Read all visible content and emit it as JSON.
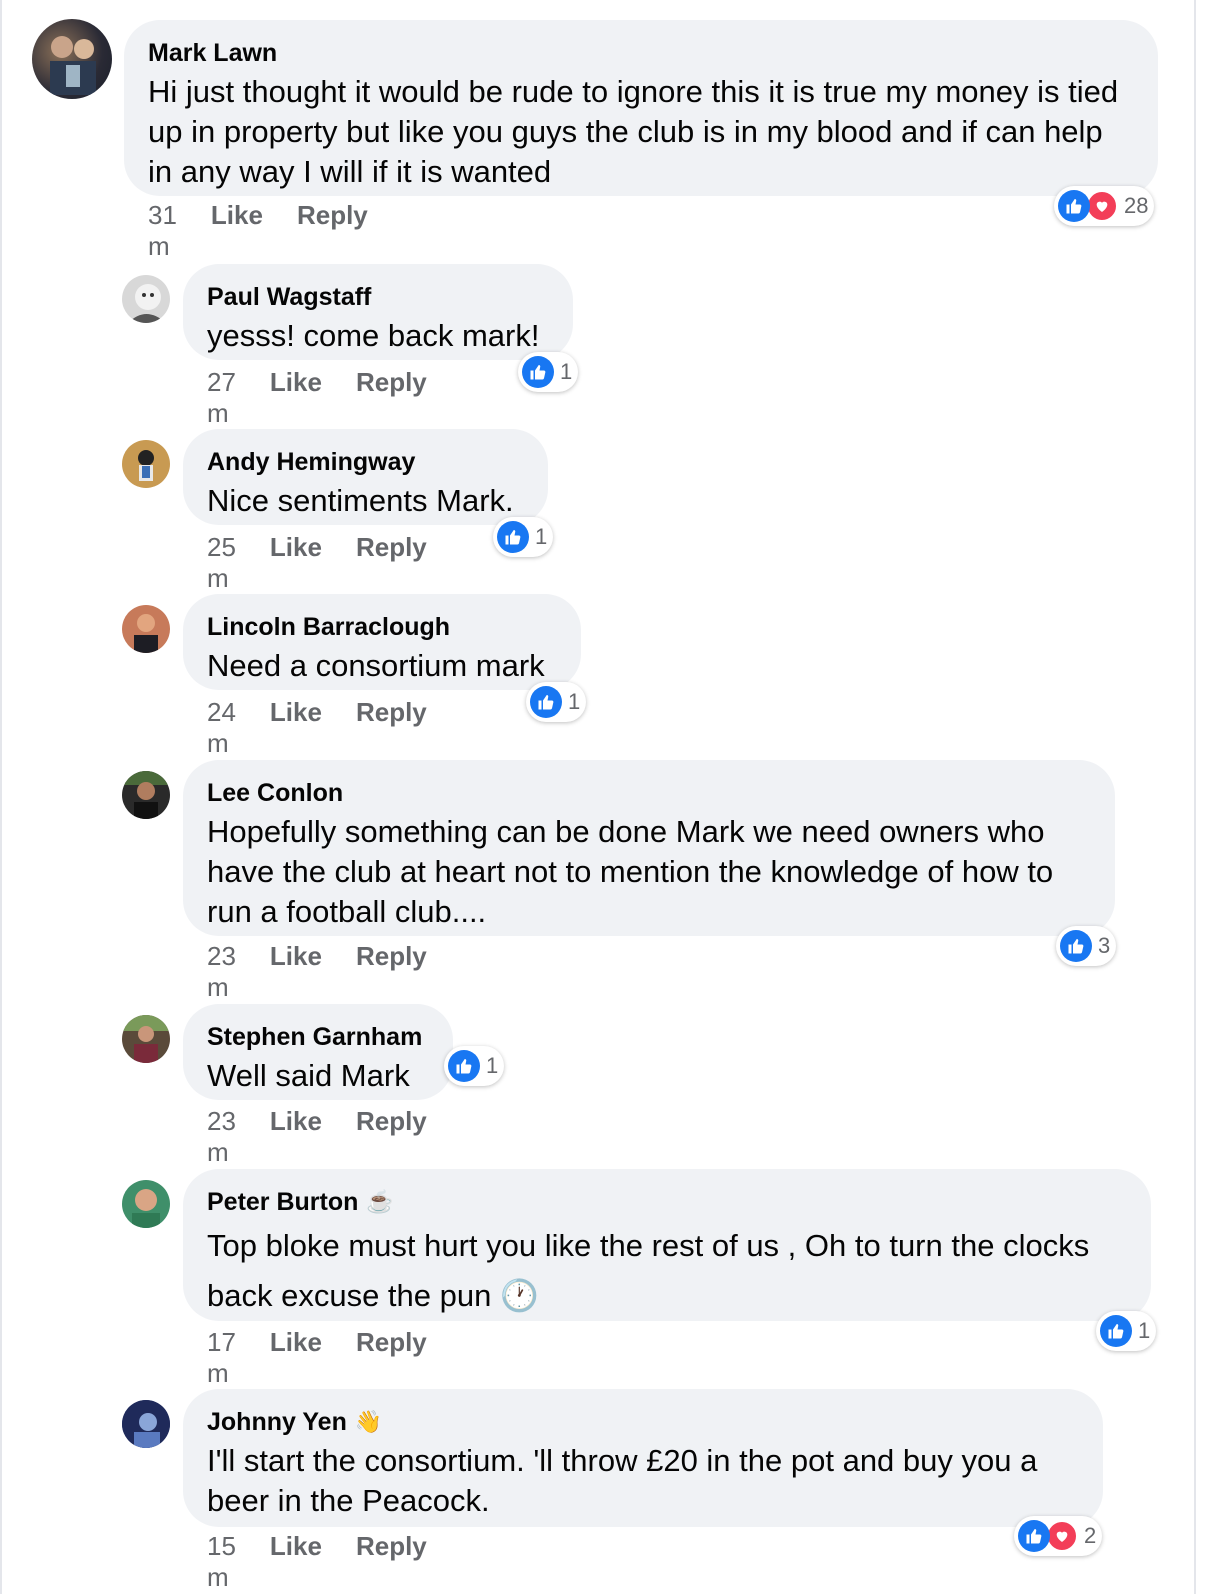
{
  "comments": [
    {
      "author": "Mark Lawn",
      "text": "Hi just thought it would be rude to ignore this it is true my money is tied up in property but like you guys the club is in my blood and if can help in any way I will if it is wanted",
      "time": "31 m",
      "like": "Like",
      "reply": "Reply",
      "reaction_count": "28",
      "reactions": [
        "like",
        "love"
      ]
    },
    {
      "author": "Paul Wagstaff",
      "text": "yesss! come back mark!",
      "time": "27 m",
      "like": "Like",
      "reply": "Reply",
      "reaction_count": "1",
      "reactions": [
        "like"
      ]
    },
    {
      "author": "Andy Hemingway",
      "text": "Nice sentiments Mark.",
      "time": "25 m",
      "like": "Like",
      "reply": "Reply",
      "reaction_count": "1",
      "reactions": [
        "like"
      ]
    },
    {
      "author": "Lincoln Barraclough",
      "text": "Need a consortium mark",
      "time": "24 m",
      "like": "Like",
      "reply": "Reply",
      "reaction_count": "1",
      "reactions": [
        "like"
      ]
    },
    {
      "author": "Lee Conlon",
      "text": "Hopefully something can be done Mark we need owners who have the club at heart not to mention the knowledge of how to run a football club....",
      "time": "23 m",
      "like": "Like",
      "reply": "Reply",
      "reaction_count": "3",
      "reactions": [
        "like"
      ]
    },
    {
      "author": "Stephen Garnham",
      "text": "Well said Mark",
      "time": "23 m",
      "like": "Like",
      "reply": "Reply",
      "reaction_count": "1",
      "reactions": [
        "like"
      ]
    },
    {
      "author": "Peter Burton",
      "author_emoji": "☕",
      "text": "Top bloke must hurt you like the rest of us , Oh to turn the clocks back excuse the pun 🕐",
      "time": "17 m",
      "like": "Like",
      "reply": "Reply",
      "reaction_count": "1",
      "reactions": [
        "like"
      ]
    },
    {
      "author": "Johnny Yen",
      "author_emoji": "👋",
      "text": "I'll start the consortium. 'll throw £20 in the pot and buy you a beer in the Peacock.",
      "time": "15 m",
      "like": "Like",
      "reply": "Reply",
      "reaction_count": "2",
      "reactions": [
        "like",
        "love"
      ]
    }
  ],
  "colors": {
    "accent": "#1877f2",
    "love": "#f33e58",
    "bubble": "#f0f2f5",
    "meta": "#65676b"
  },
  "icons": {
    "like": "thumbs-up-icon",
    "love": "heart-icon"
  }
}
